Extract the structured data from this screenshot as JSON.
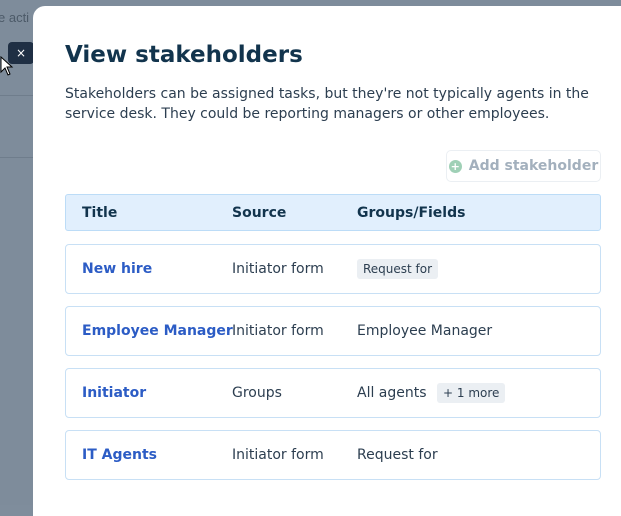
{
  "background": {
    "partial_text": "e acti",
    "close_label": "×"
  },
  "drawer": {
    "title": "View stakeholders",
    "description": "Stakeholders can be assigned tasks, but they're not typically agents in the service desk. They could be reporting managers or other employees.",
    "add_button_label": "Add stakeholder",
    "add_icon": "plus-circle-icon",
    "table": {
      "columns": [
        "Title",
        "Source",
        "Groups/Fields"
      ],
      "rows": [
        {
          "title": "New hire",
          "source": "Initiator form",
          "groups": "",
          "chip": "Request for"
        },
        {
          "title": "Employee Manager",
          "source": "Initiator form",
          "groups": "Employee Manager",
          "chip": ""
        },
        {
          "title": "Initiator",
          "source": "Groups",
          "groups": "All agents",
          "chip": "+ 1 more"
        },
        {
          "title": "IT Agents",
          "source": "Initiator form",
          "groups": "Request for",
          "chip": ""
        }
      ]
    }
  },
  "colors": {
    "accent_link": "#2c5cc5",
    "title": "#12344d",
    "header_bg": "#e1effd",
    "overlay": "#7e8c9b"
  }
}
